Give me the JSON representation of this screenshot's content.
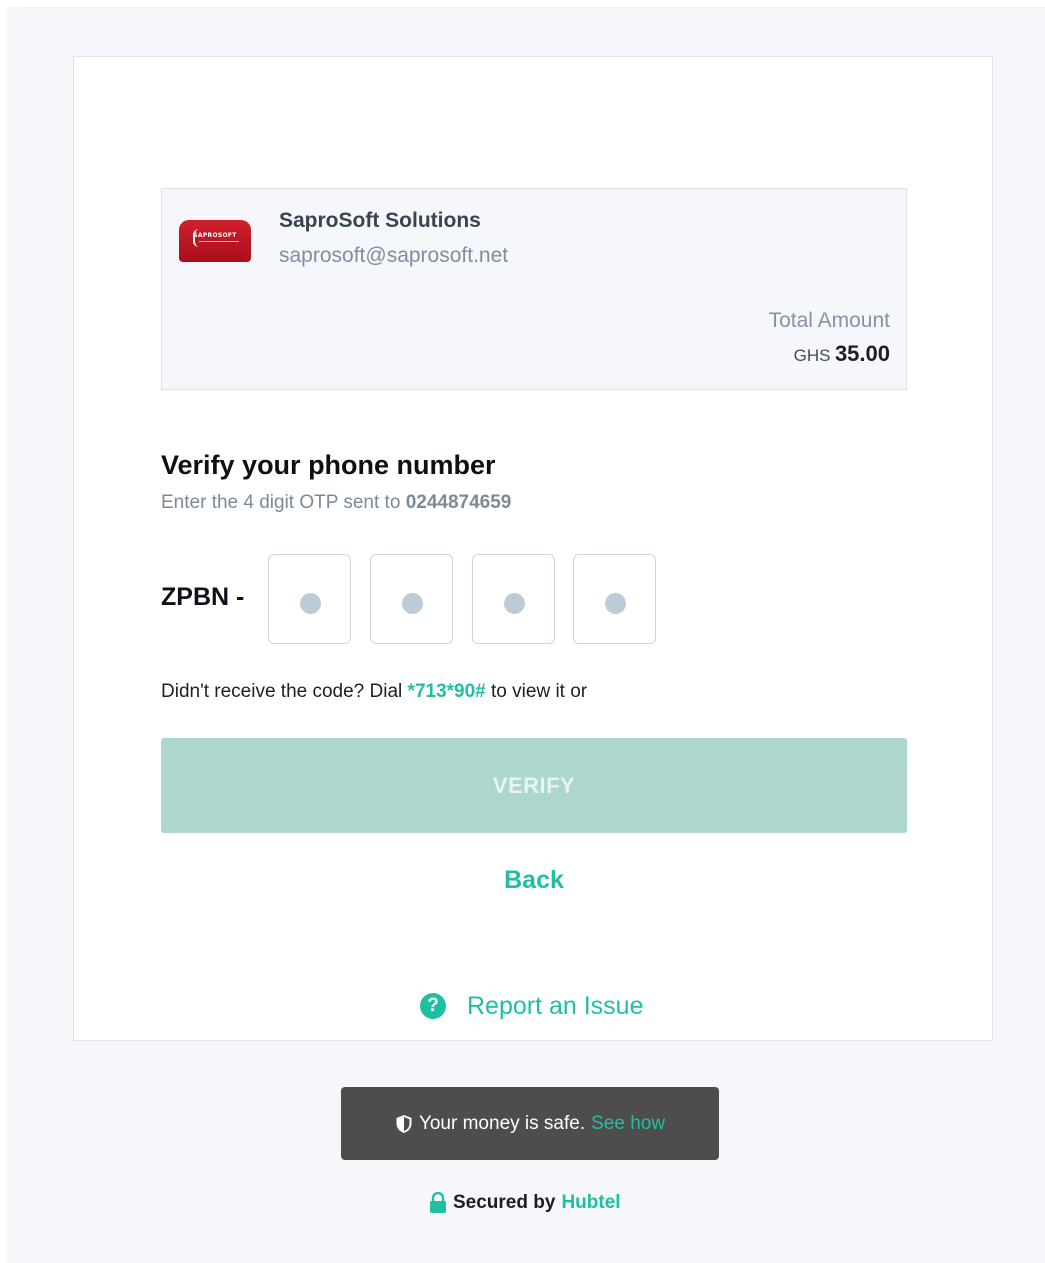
{
  "merchant": {
    "logo_text": "SAPROSOFT",
    "name": "SaproSoft Solutions",
    "email": "saprosoft@saprosoft.net",
    "total_label": "Total Amount",
    "currency": "GHS",
    "amount": "35.00"
  },
  "verify": {
    "title": "Verify your phone number",
    "subtitle_prefix": "Enter the 4 digit OTP sent to",
    "phone": "0244874659",
    "otp_prefix": "ZPBN -",
    "otp_digits": 4,
    "resend_prefix": "Didn't receive the code? Dial",
    "ussd_code": "*713*90#",
    "resend_suffix": "to view it or",
    "button_label": "VERIFY",
    "back_label": "Back"
  },
  "report": {
    "label": "Report an Issue",
    "icon": "question-circle-icon"
  },
  "footer": {
    "safe_text": "Your money is safe.",
    "see_how": "See how",
    "secured_prefix": "Secured by",
    "brand": "Hubtel"
  },
  "colors": {
    "accent": "#1fbfa3",
    "button_disabled": "#acd6ce",
    "banner_bg": "#4d4d4d"
  }
}
